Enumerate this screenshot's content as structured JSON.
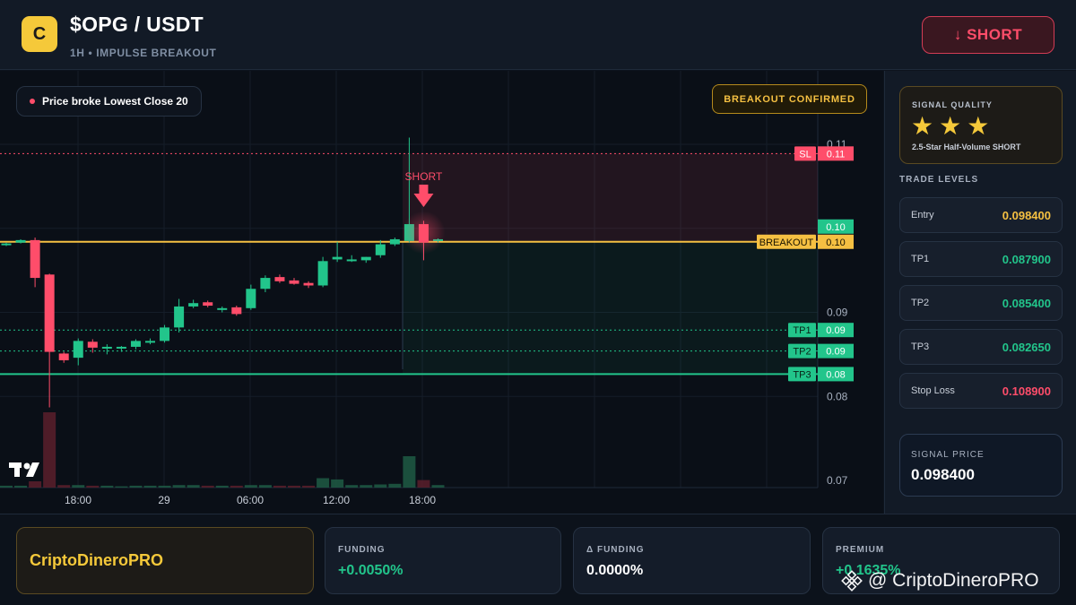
{
  "header": {
    "logo_letter": "C",
    "pair": "$OPG / USDT",
    "subtitle": "1H • IMPULSE BREAKOUT",
    "short_label": "↓ SHORT"
  },
  "chart": {
    "message": "Price broke Lowest Close 20",
    "confirm_label": "BREAKOUT CONFIRMED",
    "signal_marker_label": "SHORT",
    "tradingview_logo": "TV"
  },
  "chart_data": {
    "type": "candlestick",
    "x_tick_labels": [
      "18:00",
      "29",
      "06:00",
      "12:00",
      "18:00"
    ],
    "y_tick_labels": [
      "0.11",
      "0.10",
      "0.09",
      "0.08",
      "0.07"
    ],
    "ylim": [
      0.07,
      0.11
    ],
    "levels": [
      {
        "name": "SL",
        "label": "0.11",
        "value": 0.1089,
        "color": "#ff4d6a"
      },
      {
        "name": "BREAKOUT",
        "label": "0.10",
        "value": 0.0984,
        "color": "#f5c042"
      },
      {
        "name": "TP1",
        "label": "0.09",
        "value": 0.0879,
        "color": "#22c58b"
      },
      {
        "name": "TP2",
        "label": "0.09",
        "value": 0.0854,
        "color": "#22c58b"
      },
      {
        "name": "TP3",
        "label": "0.08",
        "value": 0.08265,
        "color": "#22c58b"
      }
    ],
    "last_price_label": "0.10",
    "candles": [
      {
        "o": 0.0981,
        "h": 0.0983,
        "l": 0.0979,
        "c": 0.0982
      },
      {
        "o": 0.0983,
        "h": 0.0987,
        "l": 0.0982,
        "c": 0.0986
      },
      {
        "o": 0.0986,
        "h": 0.0989,
        "l": 0.093,
        "c": 0.0941
      },
      {
        "o": 0.0945,
        "h": 0.0946,
        "l": 0.0787,
        "c": 0.0853
      },
      {
        "o": 0.0851,
        "h": 0.0853,
        "l": 0.084,
        "c": 0.0843
      },
      {
        "o": 0.0846,
        "h": 0.0869,
        "l": 0.0837,
        "c": 0.0866
      },
      {
        "o": 0.0865,
        "h": 0.0868,
        "l": 0.0852,
        "c": 0.0858
      },
      {
        "o": 0.0857,
        "h": 0.0862,
        "l": 0.085,
        "c": 0.0859
      },
      {
        "o": 0.0857,
        "h": 0.086,
        "l": 0.0853,
        "c": 0.0859
      },
      {
        "o": 0.0859,
        "h": 0.0868,
        "l": 0.0856,
        "c": 0.0866
      },
      {
        "o": 0.0865,
        "h": 0.0869,
        "l": 0.0862,
        "c": 0.0866
      },
      {
        "o": 0.0866,
        "h": 0.0885,
        "l": 0.0864,
        "c": 0.0882
      },
      {
        "o": 0.0882,
        "h": 0.0916,
        "l": 0.0876,
        "c": 0.0907
      },
      {
        "o": 0.0907,
        "h": 0.0915,
        "l": 0.0905,
        "c": 0.0911
      },
      {
        "o": 0.0912,
        "h": 0.0914,
        "l": 0.0906,
        "c": 0.0908
      },
      {
        "o": 0.0904,
        "h": 0.0907,
        "l": 0.09,
        "c": 0.0905
      },
      {
        "o": 0.0906,
        "h": 0.0908,
        "l": 0.0896,
        "c": 0.0898
      },
      {
        "o": 0.0905,
        "h": 0.0933,
        "l": 0.0903,
        "c": 0.0928
      },
      {
        "o": 0.0928,
        "h": 0.0944,
        "l": 0.0924,
        "c": 0.0941
      },
      {
        "o": 0.0942,
        "h": 0.0945,
        "l": 0.0935,
        "c": 0.0937
      },
      {
        "o": 0.0938,
        "h": 0.0941,
        "l": 0.0933,
        "c": 0.0934
      },
      {
        "o": 0.0935,
        "h": 0.0937,
        "l": 0.0929,
        "c": 0.0932
      },
      {
        "o": 0.0932,
        "h": 0.0966,
        "l": 0.093,
        "c": 0.0961
      },
      {
        "o": 0.0963,
        "h": 0.0984,
        "l": 0.096,
        "c": 0.0966
      },
      {
        "o": 0.0963,
        "h": 0.0968,
        "l": 0.096,
        "c": 0.0963
      },
      {
        "o": 0.0962,
        "h": 0.0966,
        "l": 0.0959,
        "c": 0.0966
      },
      {
        "o": 0.0968,
        "h": 0.0986,
        "l": 0.0965,
        "c": 0.0981
      },
      {
        "o": 0.0981,
        "h": 0.0989,
        "l": 0.0979,
        "c": 0.0987
      },
      {
        "o": 0.0985,
        "h": 0.1108,
        "l": 0.0983,
        "c": 0.1005
      },
      {
        "o": 0.1005,
        "h": 0.1009,
        "l": 0.0962,
        "c": 0.0983
      },
      {
        "o": 0.0985,
        "h": 0.0988,
        "l": 0.0983,
        "c": 0.0987
      }
    ],
    "volumes": [
      0.3,
      0.3,
      1.0,
      12.0,
      0.4,
      0.4,
      0.3,
      0.3,
      0.2,
      0.3,
      0.3,
      0.3,
      0.4,
      0.4,
      0.3,
      0.3,
      0.3,
      0.4,
      0.4,
      0.3,
      0.3,
      0.3,
      1.5,
      1.3,
      0.4,
      0.4,
      0.5,
      0.6,
      5.0,
      1.2,
      0.4
    ]
  },
  "panel": {
    "quality_title": "SIGNAL QUALITY",
    "stars": [
      "★",
      "★",
      "★"
    ],
    "quality_desc": "2.5-Star Half-Volume SHORT",
    "levels_title": "TRADE LEVELS",
    "levels": [
      {
        "name": "Entry",
        "value": "0.098400",
        "color": "#f5c042"
      },
      {
        "name": "TP1",
        "value": "0.087900",
        "color": "#22c58b"
      },
      {
        "name": "TP2",
        "value": "0.085400",
        "color": "#22c58b"
      },
      {
        "name": "TP3",
        "value": "0.082650",
        "color": "#22c58b"
      },
      {
        "name": "Stop Loss",
        "value": "0.108900",
        "color": "#ff4d6a"
      }
    ],
    "signal_price_label": "SIGNAL PRICE",
    "signal_price_value": "0.098400"
  },
  "footer": {
    "brand": "CriptoDineroPRO",
    "funding_label": "FUNDING",
    "funding_value": "+0.0050%",
    "delta_label": "Δ FUNDING",
    "delta_value": "0.0000%",
    "premium_label": "PREMIUM",
    "premium_value": "+0.1635%",
    "watermark": "@ CriptoDineroPRO"
  }
}
